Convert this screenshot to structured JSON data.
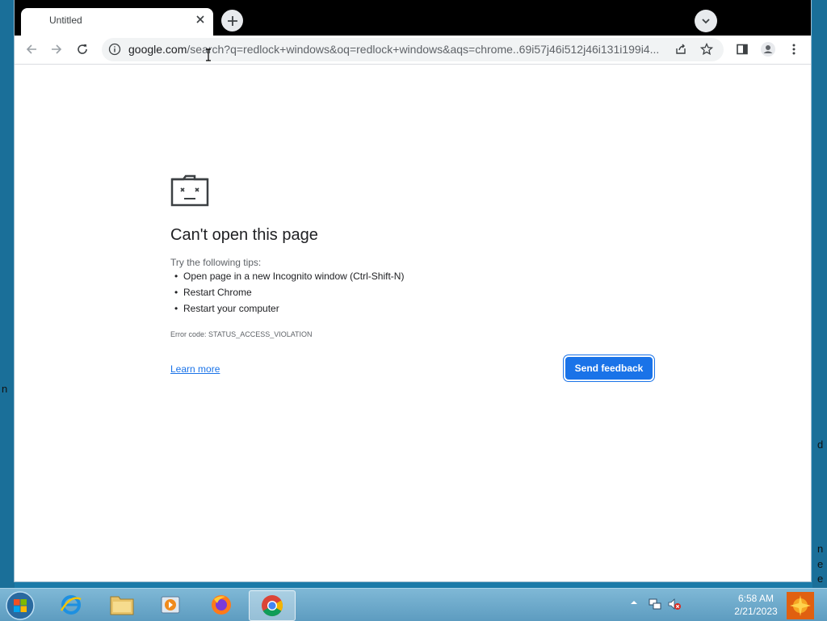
{
  "browser": {
    "tab": {
      "title": "Untitled"
    },
    "url": {
      "host": "google.com",
      "rest": "/search?q=redlock+windows&oq=redlock+windows&aqs=chrome..69i57j46i512j46i131i199i4..."
    }
  },
  "error_page": {
    "heading": "Can't open this page",
    "tips_intro": "Try the following tips:",
    "tips": [
      "Open page in a new Incognito window (Ctrl-Shift-N)",
      "Restart Chrome",
      "Restart your computer"
    ],
    "error_code": "Error code: STATUS_ACCESS_VIOLATION",
    "learn_more": "Learn more",
    "send_feedback": "Send feedback"
  },
  "taskbar": {
    "time": "6:58 AM",
    "date": "2/21/2023",
    "pinned": [
      "internet-explorer",
      "file-explorer",
      "media-player",
      "firefox",
      "chrome"
    ]
  },
  "desktop_fragments": {
    "left": "n",
    "right1": "d",
    "right2": "n",
    "right3": "e",
    "right4": "e"
  },
  "colors": {
    "accent": "#1a73e8",
    "taskbar": "#6aa8c9"
  }
}
